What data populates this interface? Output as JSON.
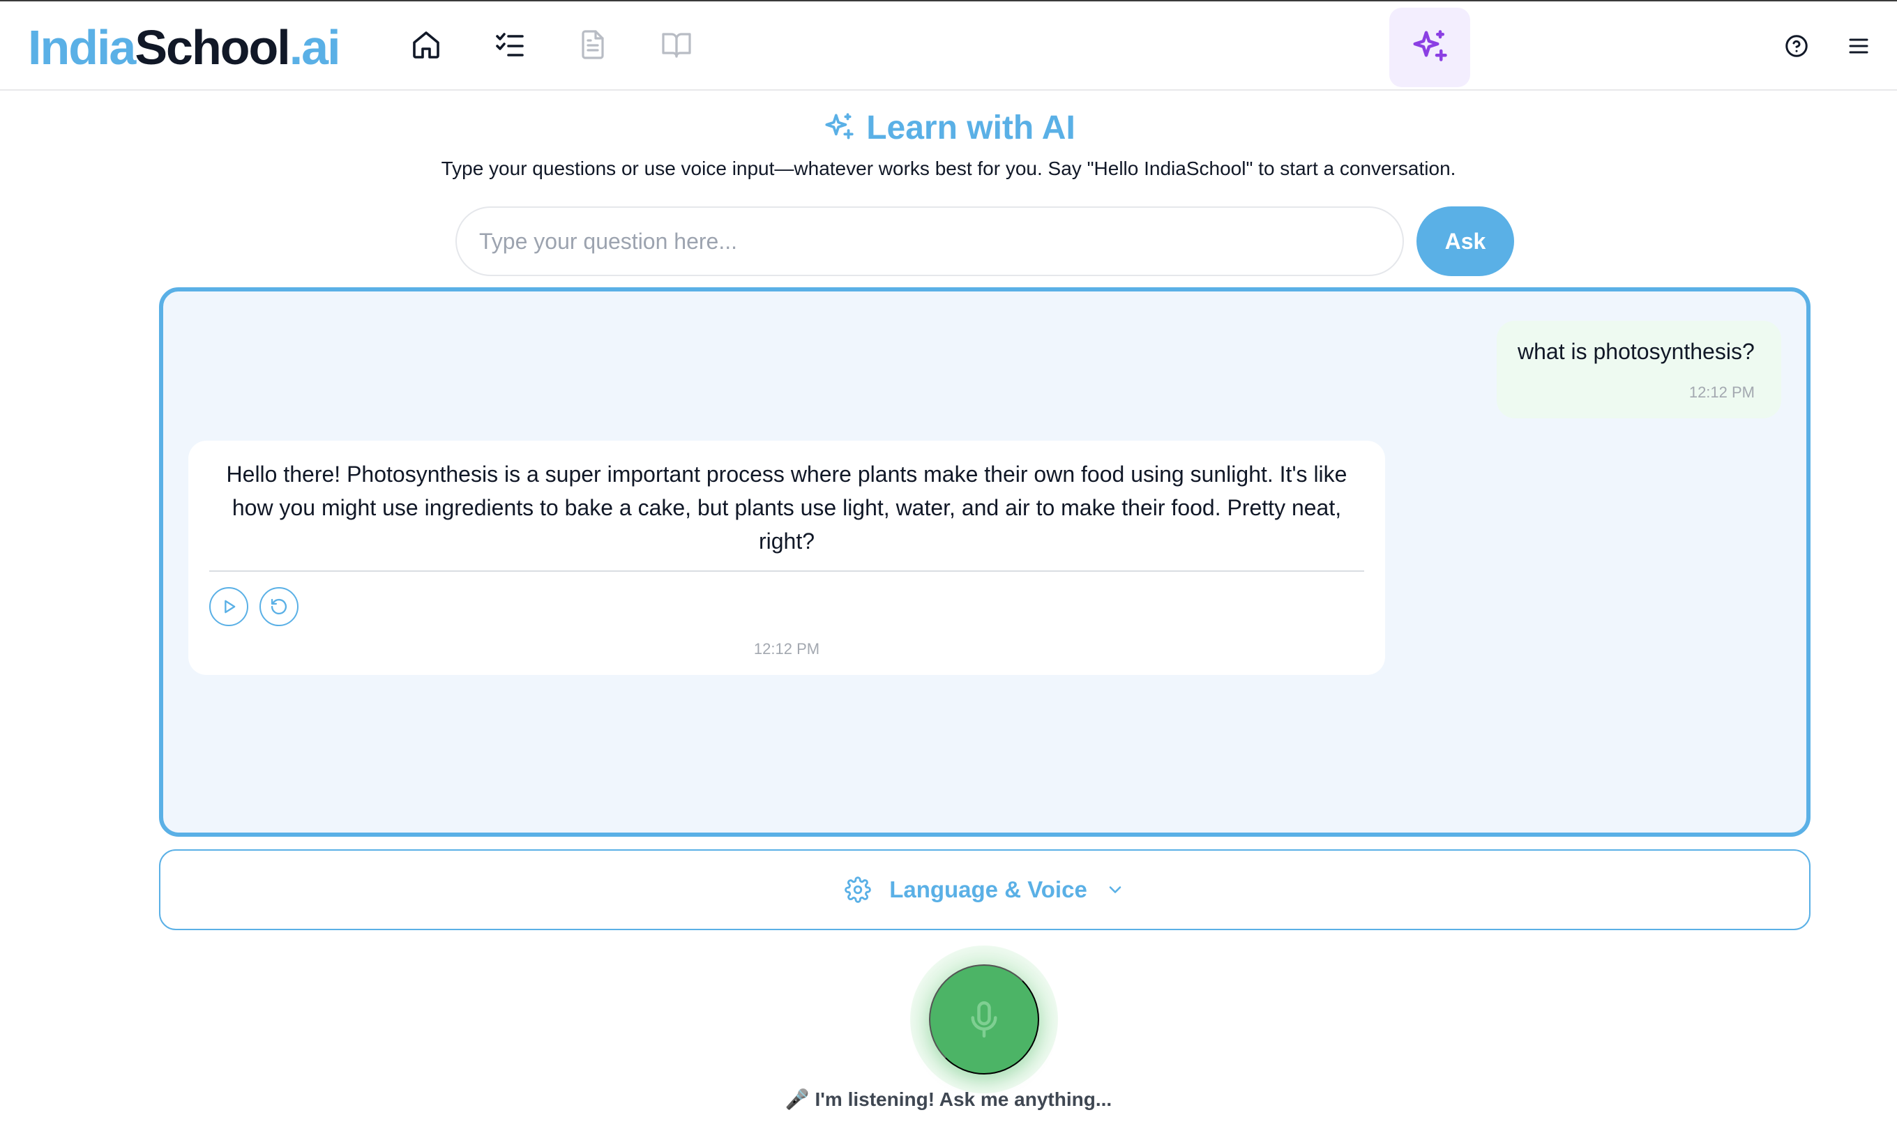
{
  "brand": {
    "part1": "India",
    "part2": "School",
    "part3": ".ai"
  },
  "nav": {
    "icons": [
      "home-icon",
      "checklist-icon",
      "document-icon",
      "book-icon"
    ],
    "ai_icon": "sparkles-icon",
    "help_icon": "help-circle-icon",
    "menu_icon": "hamburger-menu-icon"
  },
  "page": {
    "title": "Learn with AI",
    "subtitle": "Type your questions or use voice input—whatever works best for you. Say \"Hello IndiaSchool\" to start a conversation."
  },
  "search": {
    "value": "",
    "placeholder": "Type your question here...",
    "ask_label": "Ask"
  },
  "chat": {
    "messages": [
      {
        "role": "user",
        "text": "what is photosynthesis?",
        "time": "12:12 PM"
      },
      {
        "role": "assistant",
        "text": "Hello there! Photosynthesis is a super important process where plants make their own food using sunlight. It's like how you might use ingredients to bake a cake, but plants use light, water, and air to make their food. Pretty neat, right?",
        "time": "12:12 PM"
      }
    ]
  },
  "settings": {
    "label": "Language & Voice"
  },
  "voice": {
    "status": "🎤 I'm listening! Ask me anything..."
  },
  "colors": {
    "accent": "#5ab0e6",
    "ai_purple": "#8b3fe3",
    "mic_green": "#4cb466",
    "chat_bg": "#f0f6fd",
    "user_bubble": "#eefaf1"
  }
}
